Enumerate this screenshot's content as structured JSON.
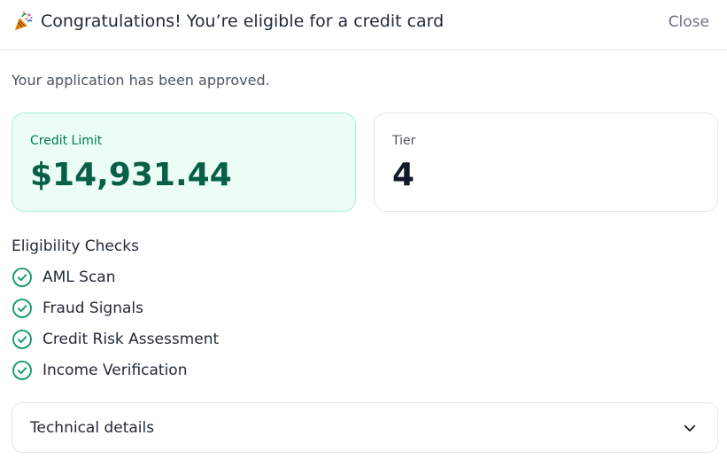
{
  "header": {
    "title": "Congratulations! You’re eligible for a credit card",
    "close_label": "Close",
    "icon": "party-popper-icon"
  },
  "subtitle": "Your application has been approved.",
  "cards": {
    "credit_limit": {
      "label": "Credit Limit",
      "value": "$14,931.44"
    },
    "tier": {
      "label": "Tier",
      "value": "4"
    }
  },
  "eligibility": {
    "title": "Eligibility Checks",
    "items": [
      {
        "label": "AML Scan",
        "icon": "check-circle-icon"
      },
      {
        "label": "Fraud Signals",
        "icon": "check-circle-icon"
      },
      {
        "label": "Credit Risk Assessment",
        "icon": "check-circle-icon"
      },
      {
        "label": "Income Verification",
        "icon": "check-circle-icon"
      }
    ]
  },
  "technical_details": {
    "label": "Technical details",
    "icon": "chevron-down-icon"
  },
  "colors": {
    "accent_green": "#047857",
    "limit_card_bg": "#ecfdf5",
    "check_icon": "#059669"
  }
}
